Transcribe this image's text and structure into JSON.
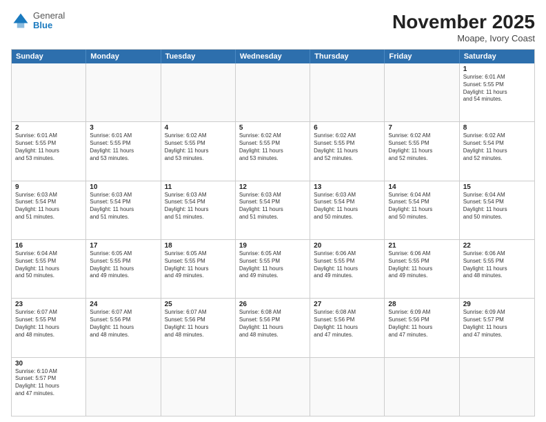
{
  "header": {
    "logo_general": "General",
    "logo_blue": "Blue",
    "month_title": "November 2025",
    "subtitle": "Moape, Ivory Coast"
  },
  "days_of_week": [
    "Sunday",
    "Monday",
    "Tuesday",
    "Wednesday",
    "Thursday",
    "Friday",
    "Saturday"
  ],
  "rows": [
    {
      "cells": [
        {
          "day": "",
          "info": ""
        },
        {
          "day": "",
          "info": ""
        },
        {
          "day": "",
          "info": ""
        },
        {
          "day": "",
          "info": ""
        },
        {
          "day": "",
          "info": ""
        },
        {
          "day": "",
          "info": ""
        },
        {
          "day": "1",
          "info": "Sunrise: 6:01 AM\nSunset: 5:55 PM\nDaylight: 11 hours\nand 54 minutes."
        }
      ]
    },
    {
      "cells": [
        {
          "day": "2",
          "info": "Sunrise: 6:01 AM\nSunset: 5:55 PM\nDaylight: 11 hours\nand 53 minutes."
        },
        {
          "day": "3",
          "info": "Sunrise: 6:01 AM\nSunset: 5:55 PM\nDaylight: 11 hours\nand 53 minutes."
        },
        {
          "day": "4",
          "info": "Sunrise: 6:02 AM\nSunset: 5:55 PM\nDaylight: 11 hours\nand 53 minutes."
        },
        {
          "day": "5",
          "info": "Sunrise: 6:02 AM\nSunset: 5:55 PM\nDaylight: 11 hours\nand 53 minutes."
        },
        {
          "day": "6",
          "info": "Sunrise: 6:02 AM\nSunset: 5:55 PM\nDaylight: 11 hours\nand 52 minutes."
        },
        {
          "day": "7",
          "info": "Sunrise: 6:02 AM\nSunset: 5:55 PM\nDaylight: 11 hours\nand 52 minutes."
        },
        {
          "day": "8",
          "info": "Sunrise: 6:02 AM\nSunset: 5:54 PM\nDaylight: 11 hours\nand 52 minutes."
        }
      ]
    },
    {
      "cells": [
        {
          "day": "9",
          "info": "Sunrise: 6:03 AM\nSunset: 5:54 PM\nDaylight: 11 hours\nand 51 minutes."
        },
        {
          "day": "10",
          "info": "Sunrise: 6:03 AM\nSunset: 5:54 PM\nDaylight: 11 hours\nand 51 minutes."
        },
        {
          "day": "11",
          "info": "Sunrise: 6:03 AM\nSunset: 5:54 PM\nDaylight: 11 hours\nand 51 minutes."
        },
        {
          "day": "12",
          "info": "Sunrise: 6:03 AM\nSunset: 5:54 PM\nDaylight: 11 hours\nand 51 minutes."
        },
        {
          "day": "13",
          "info": "Sunrise: 6:03 AM\nSunset: 5:54 PM\nDaylight: 11 hours\nand 50 minutes."
        },
        {
          "day": "14",
          "info": "Sunrise: 6:04 AM\nSunset: 5:54 PM\nDaylight: 11 hours\nand 50 minutes."
        },
        {
          "day": "15",
          "info": "Sunrise: 6:04 AM\nSunset: 5:54 PM\nDaylight: 11 hours\nand 50 minutes."
        }
      ]
    },
    {
      "cells": [
        {
          "day": "16",
          "info": "Sunrise: 6:04 AM\nSunset: 5:55 PM\nDaylight: 11 hours\nand 50 minutes."
        },
        {
          "day": "17",
          "info": "Sunrise: 6:05 AM\nSunset: 5:55 PM\nDaylight: 11 hours\nand 49 minutes."
        },
        {
          "day": "18",
          "info": "Sunrise: 6:05 AM\nSunset: 5:55 PM\nDaylight: 11 hours\nand 49 minutes."
        },
        {
          "day": "19",
          "info": "Sunrise: 6:05 AM\nSunset: 5:55 PM\nDaylight: 11 hours\nand 49 minutes."
        },
        {
          "day": "20",
          "info": "Sunrise: 6:06 AM\nSunset: 5:55 PM\nDaylight: 11 hours\nand 49 minutes."
        },
        {
          "day": "21",
          "info": "Sunrise: 6:06 AM\nSunset: 5:55 PM\nDaylight: 11 hours\nand 49 minutes."
        },
        {
          "day": "22",
          "info": "Sunrise: 6:06 AM\nSunset: 5:55 PM\nDaylight: 11 hours\nand 48 minutes."
        }
      ]
    },
    {
      "cells": [
        {
          "day": "23",
          "info": "Sunrise: 6:07 AM\nSunset: 5:55 PM\nDaylight: 11 hours\nand 48 minutes."
        },
        {
          "day": "24",
          "info": "Sunrise: 6:07 AM\nSunset: 5:56 PM\nDaylight: 11 hours\nand 48 minutes."
        },
        {
          "day": "25",
          "info": "Sunrise: 6:07 AM\nSunset: 5:56 PM\nDaylight: 11 hours\nand 48 minutes."
        },
        {
          "day": "26",
          "info": "Sunrise: 6:08 AM\nSunset: 5:56 PM\nDaylight: 11 hours\nand 48 minutes."
        },
        {
          "day": "27",
          "info": "Sunrise: 6:08 AM\nSunset: 5:56 PM\nDaylight: 11 hours\nand 47 minutes."
        },
        {
          "day": "28",
          "info": "Sunrise: 6:09 AM\nSunset: 5:56 PM\nDaylight: 11 hours\nand 47 minutes."
        },
        {
          "day": "29",
          "info": "Sunrise: 6:09 AM\nSunset: 5:57 PM\nDaylight: 11 hours\nand 47 minutes."
        }
      ]
    },
    {
      "cells": [
        {
          "day": "30",
          "info": "Sunrise: 6:10 AM\nSunset: 5:57 PM\nDaylight: 11 hours\nand 47 minutes."
        },
        {
          "day": "",
          "info": ""
        },
        {
          "day": "",
          "info": ""
        },
        {
          "day": "",
          "info": ""
        },
        {
          "day": "",
          "info": ""
        },
        {
          "day": "",
          "info": ""
        },
        {
          "day": "",
          "info": ""
        }
      ]
    }
  ]
}
